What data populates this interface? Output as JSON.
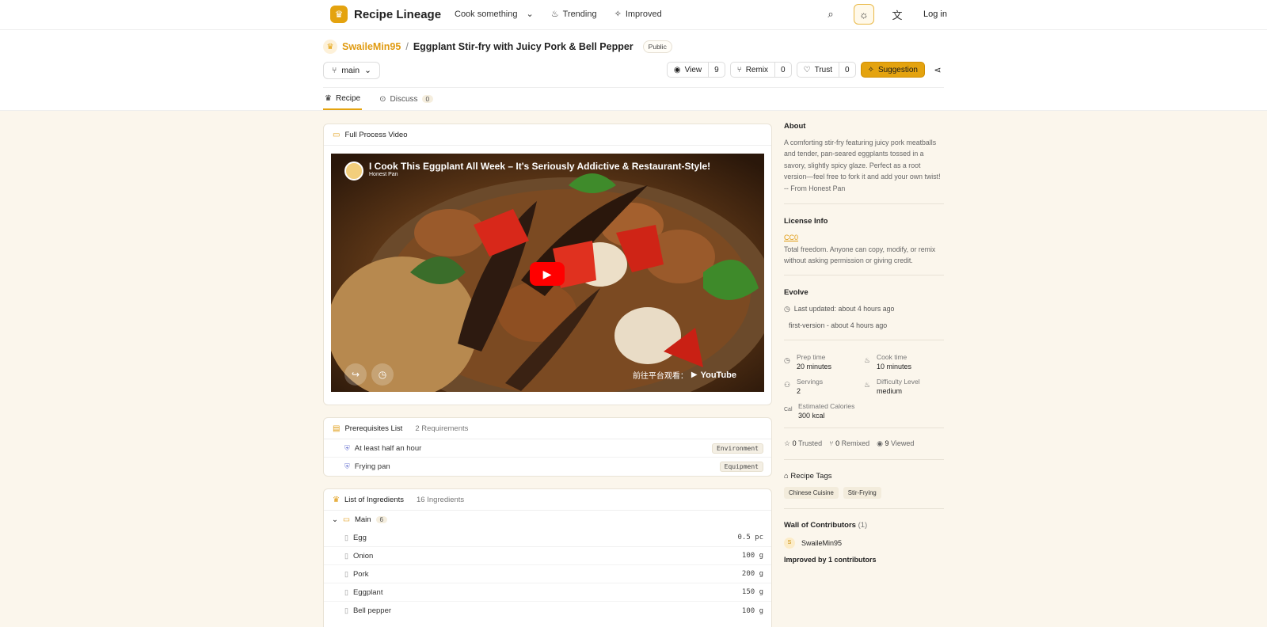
{
  "app": {
    "name": "Recipe Lineage"
  },
  "nav": {
    "cook": "Cook something",
    "trending": "Trending",
    "improved": "Improved",
    "login": "Log in"
  },
  "repo": {
    "owner": "SwaileMin95",
    "separator": "/",
    "title": "Eggplant Stir-fry with Juicy Pork & Bell Pepper",
    "visibility": "Public",
    "branch": "main"
  },
  "actions": {
    "view": {
      "label": "View",
      "count": "9"
    },
    "remix": {
      "label": "Remix",
      "count": "0"
    },
    "trust": {
      "label": "Trust",
      "count": "0"
    },
    "suggestion": "Suggestion"
  },
  "tabs": {
    "recipe": "Recipe",
    "discuss": "Discuss",
    "discuss_count": "0"
  },
  "video": {
    "section": "Full Process Video",
    "title": "I Cook This Eggplant All Week – It's Seriously Addictive & Restaurant-Style!",
    "channel": "Honest Pan",
    "watch_on": "前往平台观看：",
    "platform": "YouTube"
  },
  "prereq": {
    "title": "Prerequisites List",
    "count_text": "2 Requirements",
    "items": [
      {
        "label": "At least half an hour",
        "tag": "Environment"
      },
      {
        "label": "Frying pan",
        "tag": "Equipment"
      }
    ]
  },
  "ingredients": {
    "title": "List of Ingredients",
    "count_text": "16 Ingredients",
    "group": {
      "name": "Main",
      "count": "6"
    },
    "items": [
      {
        "name": "Egg",
        "qty": "0.5 pc"
      },
      {
        "name": "Onion",
        "qty": "100 g"
      },
      {
        "name": "Pork",
        "qty": "200 g"
      },
      {
        "name": "Eggplant",
        "qty": "150 g"
      },
      {
        "name": "Bell pepper",
        "qty": "100 g"
      }
    ]
  },
  "about": {
    "title": "About",
    "text": "A comforting stir-fry featuring juicy pork meatballs and tender, pan-seared eggplants tossed in a savory, slightly spicy glaze. Perfect as a root version—feel free to fork it and add your own twist! -- From Honest Pan"
  },
  "license": {
    "title": "License Info",
    "name": "CC0",
    "text": "Total freedom. Anyone can copy, modify, or remix without asking permission or giving credit."
  },
  "evolve": {
    "title": "Evolve",
    "updated": "Last updated: about 4 hours ago",
    "version": "first-version - about 4 hours ago"
  },
  "stats": {
    "prep_label": "Prep time",
    "prep": "20 minutes",
    "cook_label": "Cook time",
    "cook": "10 minutes",
    "servings_label": "Servings",
    "servings": "2",
    "difficulty_label": "Difficulty Level",
    "difficulty": "medium",
    "cal_icon": "Cal",
    "calories_label": "Estimated Calories",
    "calories": "300 kcal"
  },
  "counts": {
    "trusted": "0",
    "trusted_label": "Trusted",
    "remixed": "0",
    "remixed_label": "Remixed",
    "viewed": "9",
    "viewed_label": "Viewed"
  },
  "tags": {
    "title": "Recipe Tags",
    "items": [
      "Chinese Cuisine",
      "Stir-Frying"
    ]
  },
  "contributors": {
    "title": "Wall of Contributors",
    "count": "(1)",
    "initial": "S",
    "name": "SwaileMin95",
    "footer": "Improved by 1 contributors"
  }
}
